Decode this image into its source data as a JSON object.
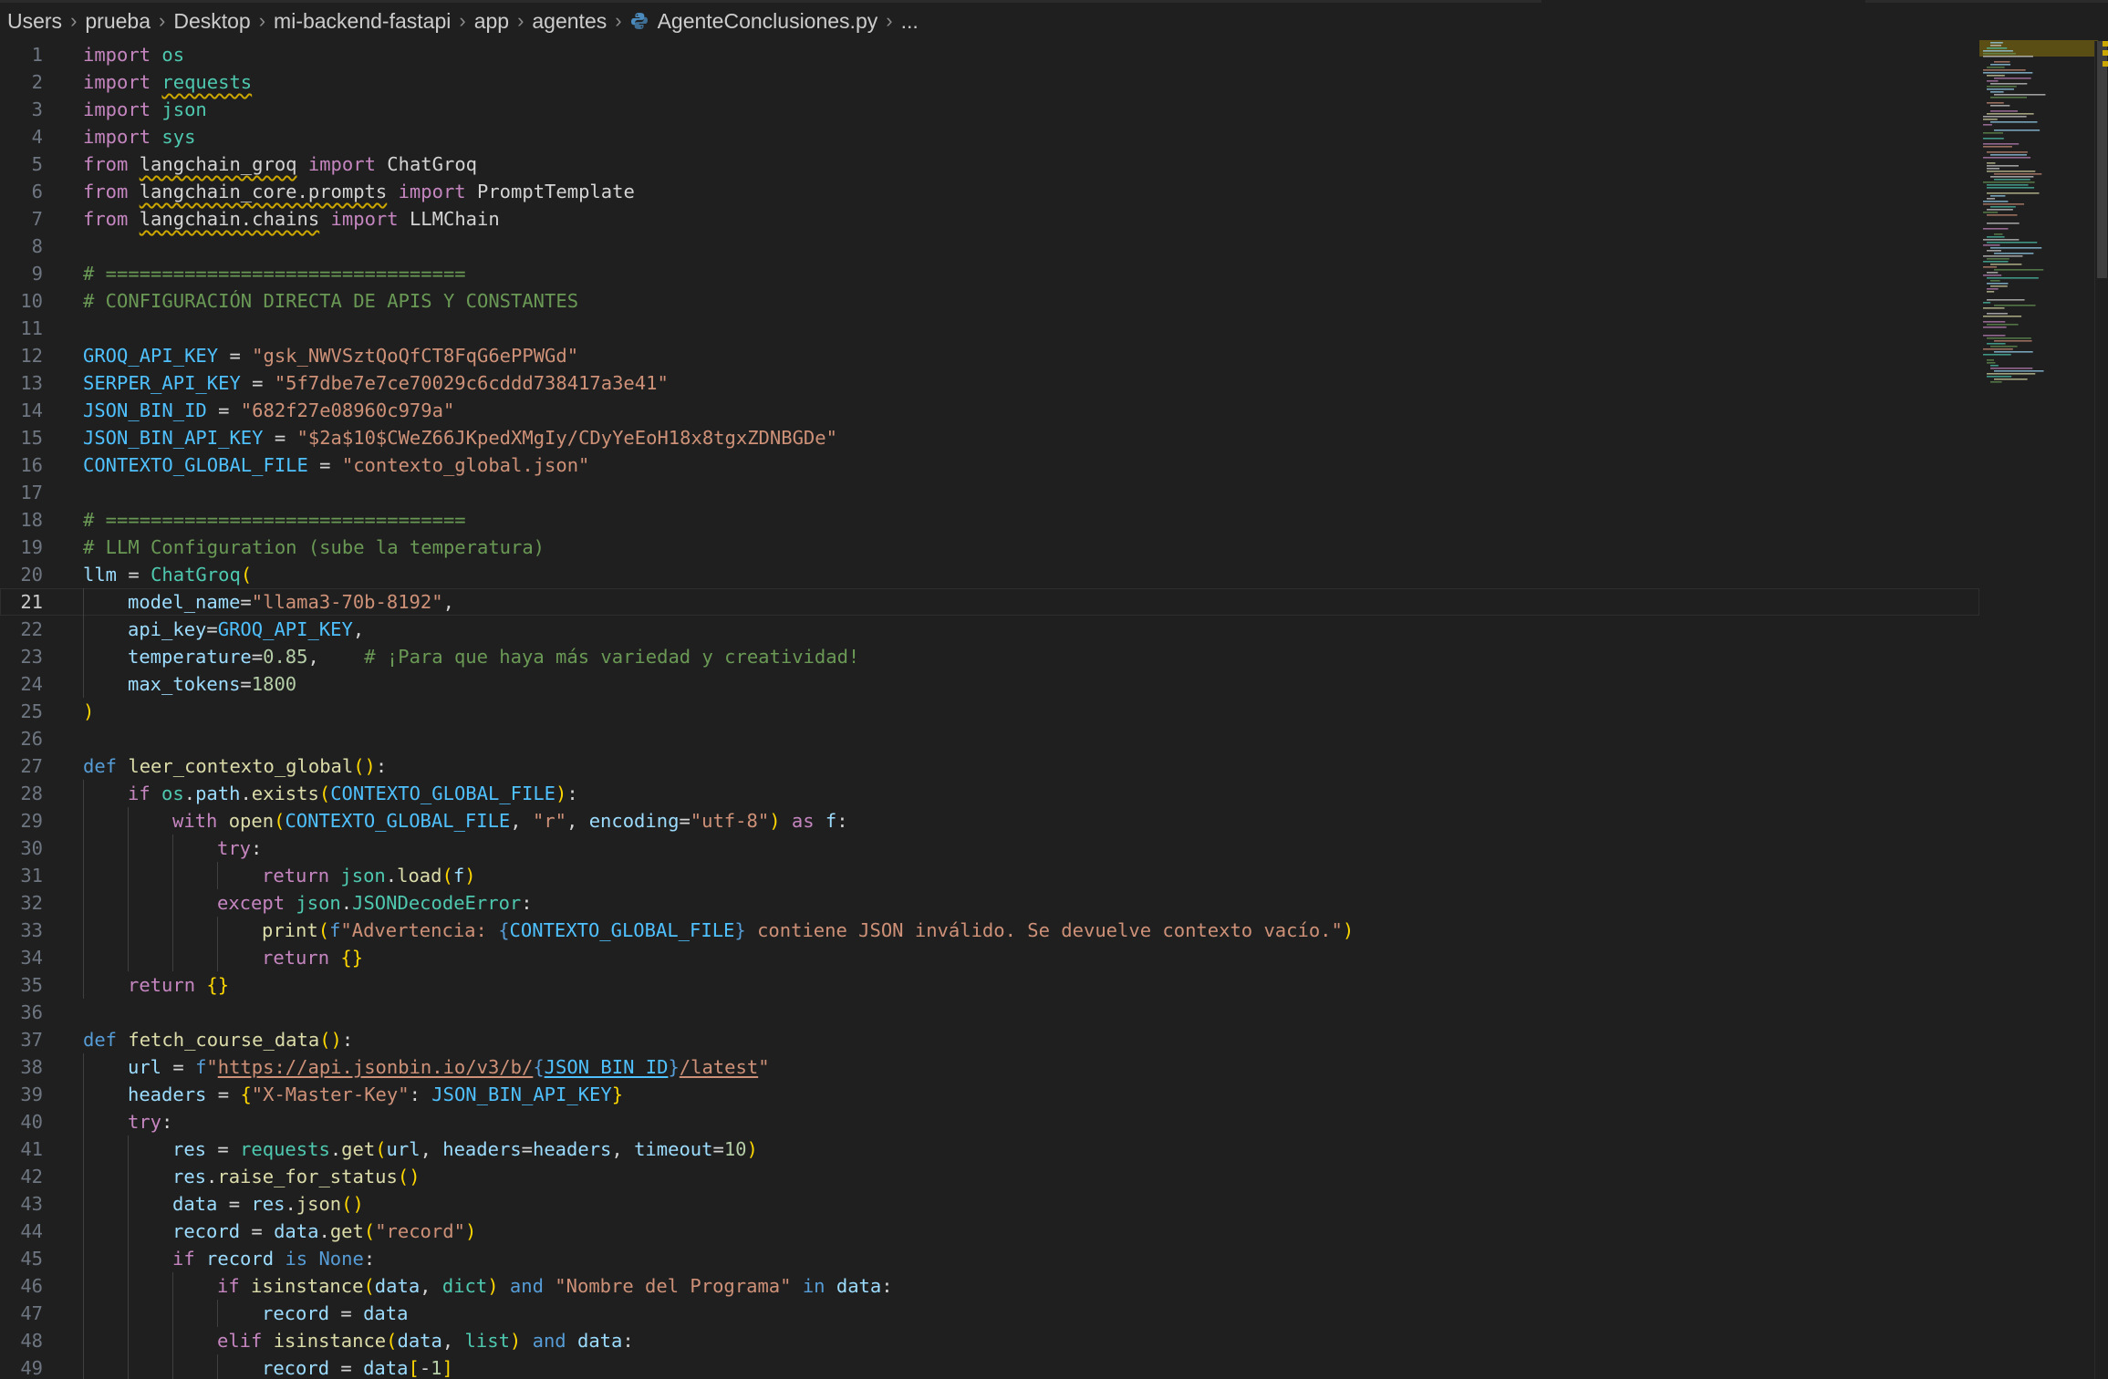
{
  "breadcrumb": {
    "items": [
      "Users",
      "prueba",
      "Desktop",
      "mi-backend-fastapi",
      "app",
      "agentes",
      "AgenteConclusiones.py",
      "..."
    ]
  },
  "editor": {
    "current_line": 21,
    "lines": [
      {
        "n": "1",
        "indent": 0,
        "t": [
          [
            "kw",
            "import"
          ],
          [
            "pl",
            " "
          ],
          [
            "mod",
            "os"
          ]
        ]
      },
      {
        "n": "2",
        "indent": 0,
        "t": [
          [
            "kw",
            "import"
          ],
          [
            "pl",
            " "
          ],
          [
            "mod sq",
            "requests"
          ]
        ]
      },
      {
        "n": "3",
        "indent": 0,
        "t": [
          [
            "kw",
            "import"
          ],
          [
            "pl",
            " "
          ],
          [
            "mod",
            "json"
          ]
        ]
      },
      {
        "n": "4",
        "indent": 0,
        "t": [
          [
            "kw",
            "import"
          ],
          [
            "pl",
            " "
          ],
          [
            "mod",
            "sys"
          ]
        ]
      },
      {
        "n": "5",
        "indent": 0,
        "t": [
          [
            "kw",
            "from"
          ],
          [
            "pl",
            " "
          ],
          [
            "pl sq",
            "langchain_groq"
          ],
          [
            "pl",
            " "
          ],
          [
            "kw",
            "import"
          ],
          [
            "pl",
            " ChatGroq"
          ]
        ]
      },
      {
        "n": "6",
        "indent": 0,
        "t": [
          [
            "kw",
            "from"
          ],
          [
            "pl",
            " "
          ],
          [
            "pl sq",
            "langchain_core.prompts"
          ],
          [
            "pl",
            " "
          ],
          [
            "kw",
            "import"
          ],
          [
            "pl",
            " PromptTemplate"
          ]
        ]
      },
      {
        "n": "7",
        "indent": 0,
        "t": [
          [
            "kw",
            "from"
          ],
          [
            "pl",
            " "
          ],
          [
            "pl sq",
            "langchain.chains"
          ],
          [
            "pl",
            " "
          ],
          [
            "kw",
            "import"
          ],
          [
            "pl",
            " LLMChain"
          ]
        ]
      },
      {
        "n": "8",
        "indent": 0,
        "t": []
      },
      {
        "n": "9",
        "indent": 0,
        "t": [
          [
            "cm",
            "# ================================"
          ]
        ]
      },
      {
        "n": "10",
        "indent": 0,
        "t": [
          [
            "cm",
            "# CONFIGURACIÓN DIRECTA DE APIS Y CONSTANTES"
          ]
        ]
      },
      {
        "n": "11",
        "indent": 0,
        "t": []
      },
      {
        "n": "12",
        "indent": 0,
        "t": [
          [
            "cn",
            "GROQ_API_KEY"
          ],
          [
            "pl",
            " = "
          ],
          [
            "st",
            "\"gsk_NWVSztQoQfCT8FqG6ePPWGd\""
          ]
        ]
      },
      {
        "n": "13",
        "indent": 0,
        "t": [
          [
            "cn",
            "SERPER_API_KEY"
          ],
          [
            "pl",
            " = "
          ],
          [
            "st",
            "\"5f7dbe7e7ce70029c6cddd738417a3e41\""
          ]
        ]
      },
      {
        "n": "14",
        "indent": 0,
        "t": [
          [
            "cn",
            "JSON_BIN_ID"
          ],
          [
            "pl",
            " = "
          ],
          [
            "st",
            "\"682f27e08960c979a\""
          ]
        ]
      },
      {
        "n": "15",
        "indent": 0,
        "t": [
          [
            "cn",
            "JSON_BIN_API_KEY"
          ],
          [
            "pl",
            " = "
          ],
          [
            "st",
            "\"$2a$10$CWeZ66JKpedXMgIy/CDyYeEoH18x8tgxZDNBGDe\""
          ]
        ]
      },
      {
        "n": "16",
        "indent": 0,
        "t": [
          [
            "cn",
            "CONTEXTO_GLOBAL_FILE"
          ],
          [
            "pl",
            " = "
          ],
          [
            "st",
            "\"contexto_global.json\""
          ]
        ]
      },
      {
        "n": "17",
        "indent": 0,
        "t": []
      },
      {
        "n": "18",
        "indent": 0,
        "t": [
          [
            "cm",
            "# ================================"
          ]
        ]
      },
      {
        "n": "19",
        "indent": 0,
        "t": [
          [
            "cm",
            "# LLM Configuration (sube la temperatura)"
          ]
        ]
      },
      {
        "n": "20",
        "indent": 0,
        "t": [
          [
            "vr",
            "llm"
          ],
          [
            "pl",
            " = "
          ],
          [
            "mod",
            "ChatGroq"
          ],
          [
            "b1",
            "("
          ]
        ]
      },
      {
        "n": "21",
        "indent": 1,
        "t": [
          [
            "vr",
            "model_name"
          ],
          [
            "pl",
            "="
          ],
          [
            "st",
            "\"llama3-70b-8192\""
          ],
          [
            "pl",
            ","
          ]
        ]
      },
      {
        "n": "22",
        "indent": 1,
        "t": [
          [
            "vr",
            "api_key"
          ],
          [
            "pl",
            "="
          ],
          [
            "cn",
            "GROQ_API_KEY"
          ],
          [
            "pl",
            ","
          ]
        ]
      },
      {
        "n": "23",
        "indent": 1,
        "t": [
          [
            "vr",
            "temperature"
          ],
          [
            "pl",
            "="
          ],
          [
            "nm",
            "0.85"
          ],
          [
            "pl",
            ",    "
          ],
          [
            "cm",
            "# ¡Para que haya más variedad y creatividad!"
          ]
        ]
      },
      {
        "n": "24",
        "indent": 1,
        "t": [
          [
            "vr",
            "max_tokens"
          ],
          [
            "pl",
            "="
          ],
          [
            "nm",
            "1800"
          ]
        ]
      },
      {
        "n": "25",
        "indent": 0,
        "t": [
          [
            "b1",
            ")"
          ]
        ]
      },
      {
        "n": "26",
        "indent": 0,
        "t": []
      },
      {
        "n": "27",
        "indent": 0,
        "t": [
          [
            "kb",
            "def"
          ],
          [
            "pl",
            " "
          ],
          [
            "fn",
            "leer_contexto_global"
          ],
          [
            "b1",
            "()"
          ],
          [
            "pl",
            ":"
          ]
        ]
      },
      {
        "n": "28",
        "indent": 1,
        "t": [
          [
            "kw",
            "if"
          ],
          [
            "pl",
            " "
          ],
          [
            "mod",
            "os"
          ],
          [
            "pl",
            "."
          ],
          [
            "vr",
            "path"
          ],
          [
            "pl",
            "."
          ],
          [
            "fn",
            "exists"
          ],
          [
            "b1",
            "("
          ],
          [
            "cn",
            "CONTEXTO_GLOBAL_FILE"
          ],
          [
            "b1",
            ")"
          ],
          [
            "pl",
            ":"
          ]
        ]
      },
      {
        "n": "29",
        "indent": 2,
        "t": [
          [
            "kw",
            "with"
          ],
          [
            "pl",
            " "
          ],
          [
            "fn",
            "open"
          ],
          [
            "b1",
            "("
          ],
          [
            "cn",
            "CONTEXTO_GLOBAL_FILE"
          ],
          [
            "pl",
            ", "
          ],
          [
            "st",
            "\"r\""
          ],
          [
            "pl",
            ", "
          ],
          [
            "vr",
            "encoding"
          ],
          [
            "pl",
            "="
          ],
          [
            "st",
            "\"utf-8\""
          ],
          [
            "b1",
            ")"
          ],
          [
            "pl",
            " "
          ],
          [
            "kw",
            "as"
          ],
          [
            "pl",
            " "
          ],
          [
            "vr",
            "f"
          ],
          [
            "pl",
            ":"
          ]
        ]
      },
      {
        "n": "30",
        "indent": 3,
        "t": [
          [
            "kw",
            "try"
          ],
          [
            "pl",
            ":"
          ]
        ]
      },
      {
        "n": "31",
        "indent": 4,
        "t": [
          [
            "kw",
            "return"
          ],
          [
            "pl",
            " "
          ],
          [
            "mod",
            "json"
          ],
          [
            "pl",
            "."
          ],
          [
            "fn",
            "load"
          ],
          [
            "b1",
            "("
          ],
          [
            "vr",
            "f"
          ],
          [
            "b1",
            ")"
          ]
        ]
      },
      {
        "n": "32",
        "indent": 3,
        "t": [
          [
            "kw",
            "except"
          ],
          [
            "pl",
            " "
          ],
          [
            "mod",
            "json"
          ],
          [
            "pl",
            "."
          ],
          [
            "mod",
            "JSONDecodeError"
          ],
          [
            "pl",
            ":"
          ]
        ]
      },
      {
        "n": "33",
        "indent": 4,
        "t": [
          [
            "fn",
            "print"
          ],
          [
            "b1",
            "("
          ],
          [
            "kb",
            "f"
          ],
          [
            "st",
            "\"Advertencia: "
          ],
          [
            "kb",
            "{"
          ],
          [
            "cn",
            "CONTEXTO_GLOBAL_FILE"
          ],
          [
            "kb",
            "}"
          ],
          [
            "st",
            " contiene JSON inválido. Se devuelve contexto vacío.\""
          ],
          [
            "b1",
            ")"
          ]
        ]
      },
      {
        "n": "34",
        "indent": 4,
        "t": [
          [
            "kw",
            "return"
          ],
          [
            "pl",
            " "
          ],
          [
            "b1",
            "{}"
          ]
        ]
      },
      {
        "n": "35",
        "indent": 1,
        "t": [
          [
            "kw",
            "return"
          ],
          [
            "pl",
            " "
          ],
          [
            "b1",
            "{}"
          ]
        ]
      },
      {
        "n": "36",
        "indent": 0,
        "t": []
      },
      {
        "n": "37",
        "indent": 0,
        "t": [
          [
            "kb",
            "def"
          ],
          [
            "pl",
            " "
          ],
          [
            "fn",
            "fetch_course_data"
          ],
          [
            "b1",
            "()"
          ],
          [
            "pl",
            ":"
          ]
        ]
      },
      {
        "n": "38",
        "indent": 1,
        "t": [
          [
            "vr",
            "url"
          ],
          [
            "pl",
            " = "
          ],
          [
            "kb",
            "f"
          ],
          [
            "st",
            "\""
          ],
          [
            "st lk",
            "https://api.jsonbin.io/v3/b/"
          ],
          [
            "kb",
            "{"
          ],
          [
            "cn lk",
            "JSON_BIN_ID"
          ],
          [
            "kb",
            "}"
          ],
          [
            "st lk",
            "/latest"
          ],
          [
            "st",
            "\""
          ]
        ]
      },
      {
        "n": "39",
        "indent": 1,
        "t": [
          [
            "vr",
            "headers"
          ],
          [
            "pl",
            " = "
          ],
          [
            "b1",
            "{"
          ],
          [
            "st",
            "\"X-Master-Key\""
          ],
          [
            "pl",
            ": "
          ],
          [
            "cn",
            "JSON_BIN_API_KEY"
          ],
          [
            "b1",
            "}"
          ]
        ]
      },
      {
        "n": "40",
        "indent": 1,
        "t": [
          [
            "kw",
            "try"
          ],
          [
            "pl",
            ":"
          ]
        ]
      },
      {
        "n": "41",
        "indent": 2,
        "t": [
          [
            "vr",
            "res"
          ],
          [
            "pl",
            " = "
          ],
          [
            "mod",
            "requests"
          ],
          [
            "pl",
            "."
          ],
          [
            "fn",
            "get"
          ],
          [
            "b1",
            "("
          ],
          [
            "vr",
            "url"
          ],
          [
            "pl",
            ", "
          ],
          [
            "vr",
            "headers"
          ],
          [
            "pl",
            "="
          ],
          [
            "vr",
            "headers"
          ],
          [
            "pl",
            ", "
          ],
          [
            "vr",
            "timeout"
          ],
          [
            "pl",
            "="
          ],
          [
            "nm",
            "10"
          ],
          [
            "b1",
            ")"
          ]
        ]
      },
      {
        "n": "42",
        "indent": 2,
        "t": [
          [
            "vr",
            "res"
          ],
          [
            "pl",
            "."
          ],
          [
            "fn",
            "raise_for_status"
          ],
          [
            "b1",
            "()"
          ]
        ]
      },
      {
        "n": "43",
        "indent": 2,
        "t": [
          [
            "vr",
            "data"
          ],
          [
            "pl",
            " = "
          ],
          [
            "vr",
            "res"
          ],
          [
            "pl",
            "."
          ],
          [
            "fn",
            "json"
          ],
          [
            "b1",
            "()"
          ]
        ]
      },
      {
        "n": "44",
        "indent": 2,
        "t": [
          [
            "vr",
            "record"
          ],
          [
            "pl",
            " = "
          ],
          [
            "vr",
            "data"
          ],
          [
            "pl",
            "."
          ],
          [
            "fn",
            "get"
          ],
          [
            "b1",
            "("
          ],
          [
            "st",
            "\"record\""
          ],
          [
            "b1",
            ")"
          ]
        ]
      },
      {
        "n": "45",
        "indent": 2,
        "t": [
          [
            "kw",
            "if"
          ],
          [
            "pl",
            " "
          ],
          [
            "vr",
            "record"
          ],
          [
            "pl",
            " "
          ],
          [
            "kb",
            "is"
          ],
          [
            "pl",
            " "
          ],
          [
            "kb",
            "None"
          ],
          [
            "pl",
            ":"
          ]
        ]
      },
      {
        "n": "46",
        "indent": 3,
        "t": [
          [
            "kw",
            "if"
          ],
          [
            "pl",
            " "
          ],
          [
            "fn",
            "isinstance"
          ],
          [
            "b1",
            "("
          ],
          [
            "vr",
            "data"
          ],
          [
            "pl",
            ", "
          ],
          [
            "mod",
            "dict"
          ],
          [
            "b1",
            ")"
          ],
          [
            "pl",
            " "
          ],
          [
            "kb",
            "and"
          ],
          [
            "pl",
            " "
          ],
          [
            "st",
            "\"Nombre del Programa\""
          ],
          [
            "pl",
            " "
          ],
          [
            "kb",
            "in"
          ],
          [
            "pl",
            " "
          ],
          [
            "vr",
            "data"
          ],
          [
            "pl",
            ":"
          ]
        ]
      },
      {
        "n": "47",
        "indent": 4,
        "t": [
          [
            "vr",
            "record"
          ],
          [
            "pl",
            " = "
          ],
          [
            "vr",
            "data"
          ]
        ]
      },
      {
        "n": "48",
        "indent": 3,
        "t": [
          [
            "kw",
            "elif"
          ],
          [
            "pl",
            " "
          ],
          [
            "fn",
            "isinstance"
          ],
          [
            "b1",
            "("
          ],
          [
            "vr",
            "data"
          ],
          [
            "pl",
            ", "
          ],
          [
            "mod",
            "list"
          ],
          [
            "b1",
            ")"
          ],
          [
            "pl",
            " "
          ],
          [
            "kb",
            "and"
          ],
          [
            "pl",
            " "
          ],
          [
            "vr",
            "data"
          ],
          [
            "pl",
            ":"
          ]
        ]
      },
      {
        "n": "49",
        "indent": 4,
        "t": [
          [
            "vr",
            "record"
          ],
          [
            "pl",
            " = "
          ],
          [
            "vr",
            "data"
          ],
          [
            "b1",
            "["
          ],
          [
            "pl",
            "-"
          ],
          [
            "nm",
            "1"
          ],
          [
            "b1",
            "]"
          ]
        ]
      }
    ]
  }
}
